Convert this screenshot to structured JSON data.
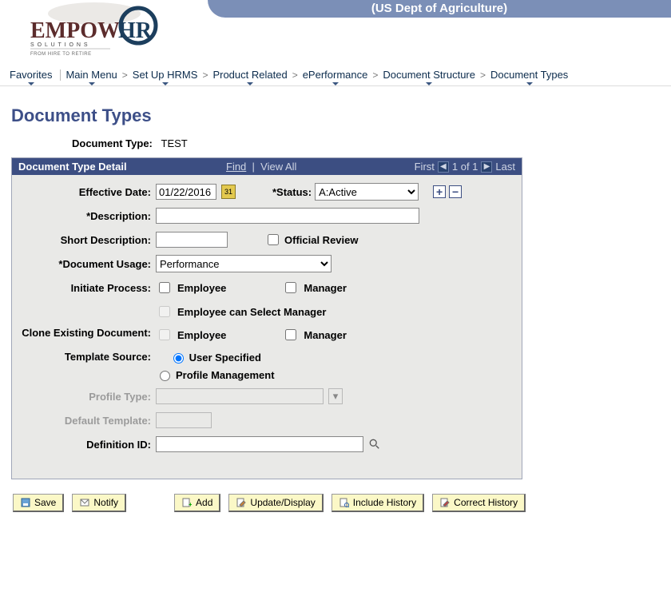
{
  "header": {
    "org": "(US Dept of Agriculture)",
    "logo": {
      "part1": "EMPOW",
      "part2": "HR",
      "line1": "S O L U T I O N S",
      "line2": "FROM HIRE TO RETIRE"
    }
  },
  "menu": {
    "favorites": "Favorites",
    "items": [
      "Main Menu",
      "Set Up HRMS",
      "Product Related",
      "ePerformance",
      "Document Structure",
      "Document Types"
    ]
  },
  "page": {
    "title": "Document Types",
    "doc_type_label": "Document Type:",
    "doc_type_value": "TEST"
  },
  "panel": {
    "title": "Document Type Detail",
    "find": "Find",
    "view_all": "View All",
    "first": "First",
    "counter": "1 of 1",
    "last": "Last"
  },
  "form": {
    "effective_date": {
      "label": "Effective Date:",
      "value": "01/22/2016"
    },
    "status": {
      "label": "*Status:",
      "value": "A:Active"
    },
    "description": {
      "label": "*Description:",
      "value": ""
    },
    "short_desc": {
      "label": "Short Description:",
      "value": ""
    },
    "official_review": {
      "label": "Official Review",
      "checked": false
    },
    "doc_usage": {
      "label": "*Document Usage:",
      "value": "Performance"
    },
    "initiate": {
      "label": "Initiate Process:",
      "employee": "Employee",
      "manager": "Manager",
      "emp_checked": false,
      "mgr_checked": false
    },
    "emp_select_mgr": {
      "label": "Employee can Select Manager",
      "checked": false
    },
    "clone": {
      "label": "Clone Existing Document:",
      "employee": "Employee",
      "manager": "Manager",
      "emp_checked": false,
      "mgr_checked": false
    },
    "template_source": {
      "label": "Template Source:",
      "user_specified": "User Specified",
      "profile_mgmt": "Profile Management",
      "selected": "user"
    },
    "profile_type": {
      "label": "Profile Type:",
      "value": ""
    },
    "default_template": {
      "label": "Default Template:",
      "value": ""
    },
    "definition_id": {
      "label": "Definition ID:",
      "value": ""
    }
  },
  "buttons": {
    "save": "Save",
    "notify": "Notify",
    "add": "Add",
    "update": "Update/Display",
    "include": "Include History",
    "correct": "Correct History"
  },
  "icons": {
    "cal": "31"
  }
}
